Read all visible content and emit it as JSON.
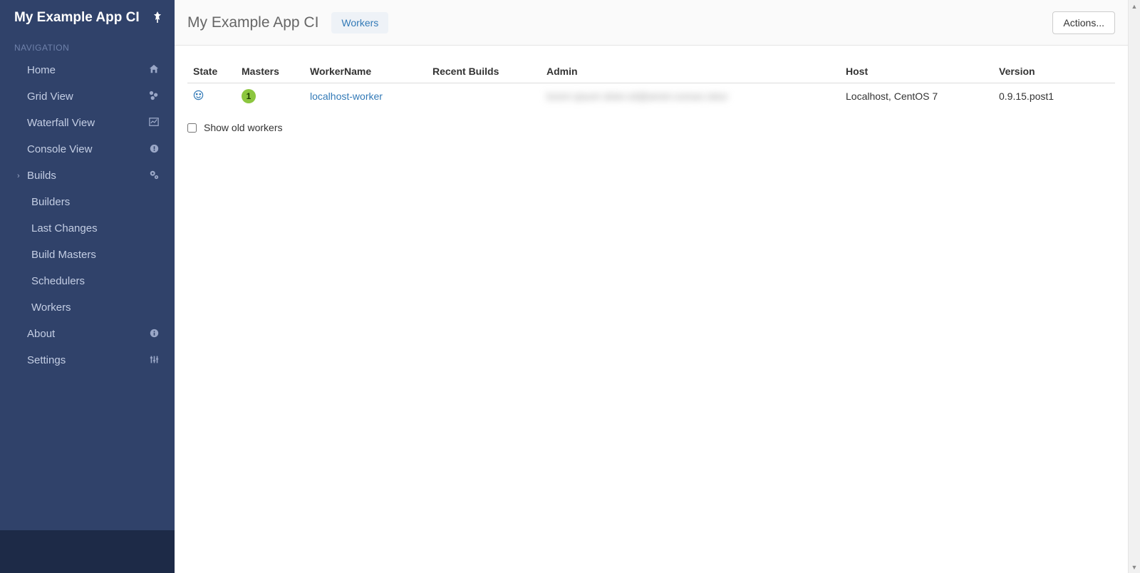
{
  "app_name": "My Example App CI",
  "sidebar": {
    "section_label": "NAVIGATION",
    "items": [
      {
        "label": "Home",
        "icon": "home-icon"
      },
      {
        "label": "Grid View",
        "icon": "grid-icon"
      },
      {
        "label": "Waterfall View",
        "icon": "chart-icon"
      },
      {
        "label": "Console View",
        "icon": "alert-icon"
      },
      {
        "label": "Builds",
        "icon": "gears-icon",
        "expanded": true,
        "children": [
          {
            "label": "Builders"
          },
          {
            "label": "Last Changes"
          },
          {
            "label": "Build Masters"
          },
          {
            "label": "Schedulers"
          },
          {
            "label": "Workers"
          }
        ]
      },
      {
        "label": "About",
        "icon": "info-icon"
      },
      {
        "label": "Settings",
        "icon": "sliders-icon"
      }
    ]
  },
  "header": {
    "title": "My Example App CI",
    "tab": "Workers",
    "actions_label": "Actions..."
  },
  "table": {
    "headers": {
      "state": "State",
      "masters": "Masters",
      "worker_name": "WorkerName",
      "recent_builds": "Recent Builds",
      "admin": "Admin",
      "host": "Host",
      "version": "Version"
    },
    "rows": [
      {
        "state_icon": "smile-icon",
        "masters": "1",
        "worker_name": "localhost-worker",
        "recent_builds": "",
        "admin": "lorem ipsum  dolor.sit@amet-consec.tetur",
        "host": "Localhost, CentOS 7",
        "version": "0.9.15.post1"
      }
    ]
  },
  "show_old_label": "Show old workers"
}
